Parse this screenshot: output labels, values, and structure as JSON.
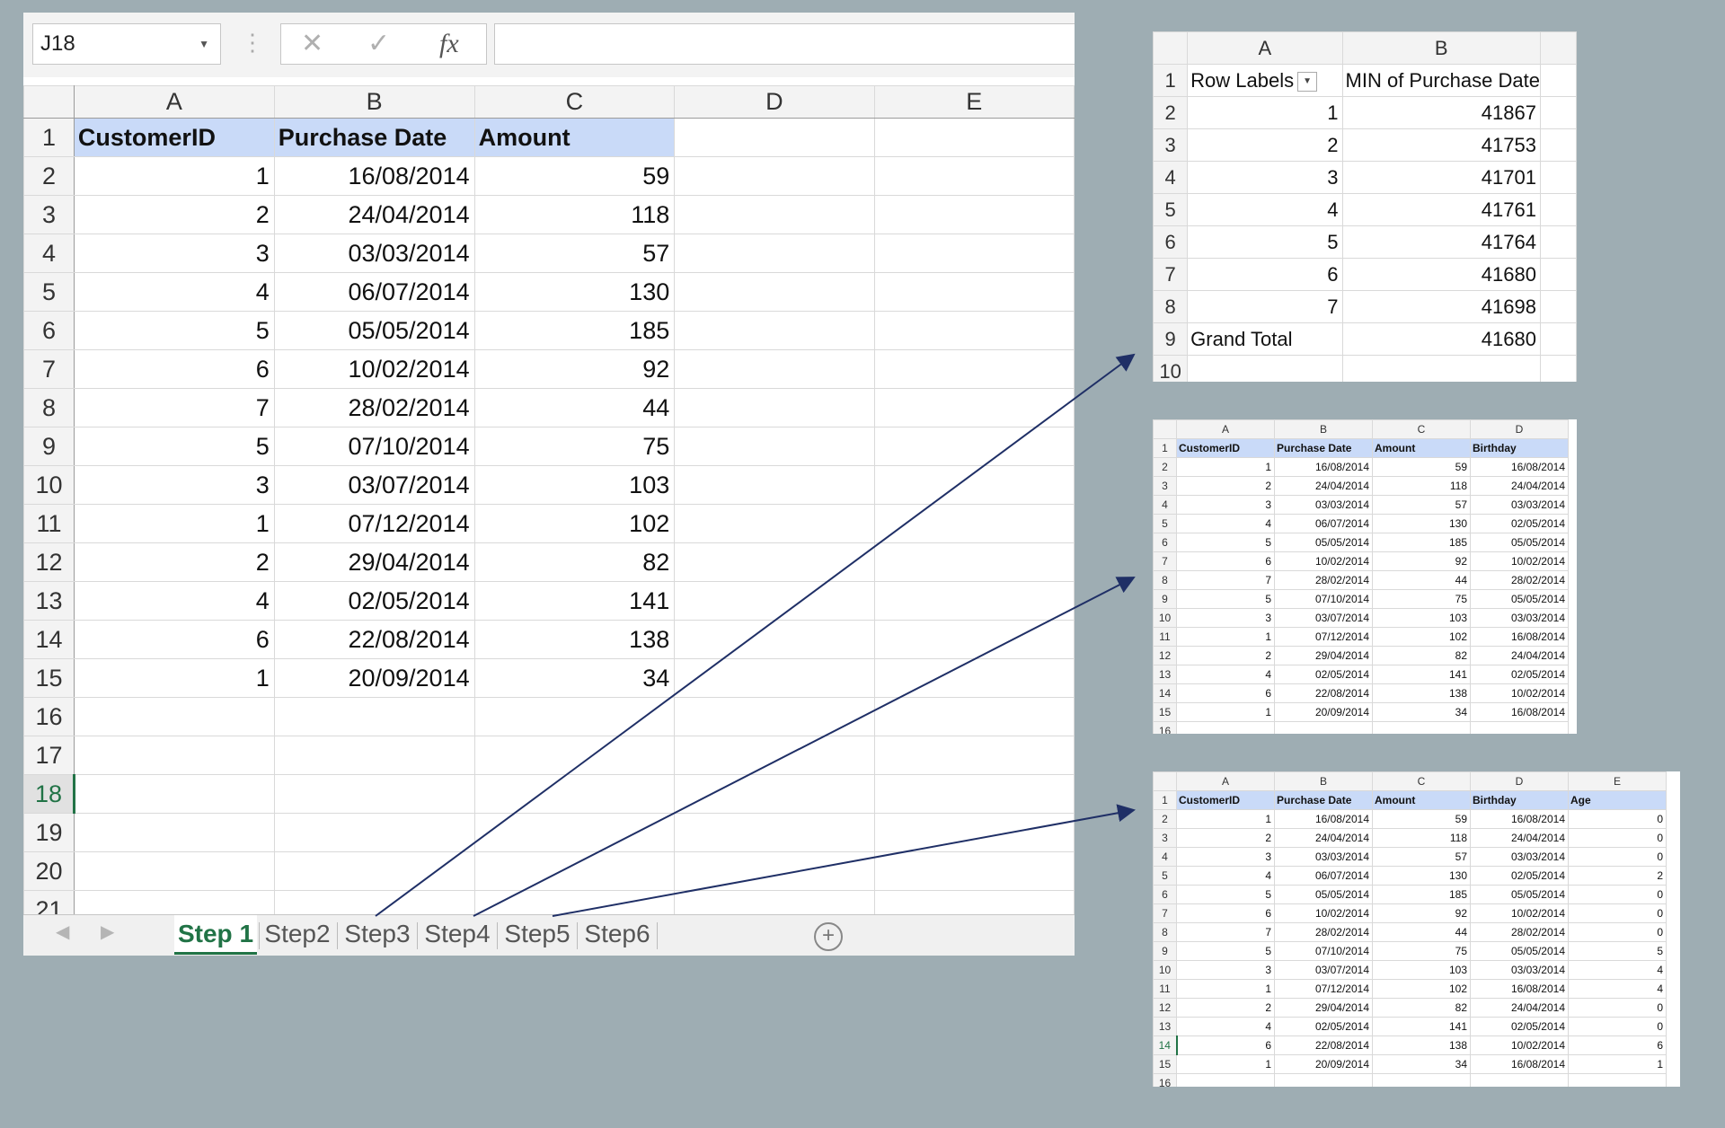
{
  "formula_bar": {
    "name_box": "J18",
    "fx_label": "fx",
    "formula": ""
  },
  "columns": [
    "A",
    "B",
    "C",
    "D",
    "E"
  ],
  "headers": [
    "CustomerID",
    "Purchase Date",
    "Amount"
  ],
  "rows": [
    {
      "id": "1",
      "date": "16/08/2014",
      "amount": "59"
    },
    {
      "id": "2",
      "date": "24/04/2014",
      "amount": "118"
    },
    {
      "id": "3",
      "date": "03/03/2014",
      "amount": "57"
    },
    {
      "id": "4",
      "date": "06/07/2014",
      "amount": "130"
    },
    {
      "id": "5",
      "date": "05/05/2014",
      "amount": "185"
    },
    {
      "id": "6",
      "date": "10/02/2014",
      "amount": "92"
    },
    {
      "id": "7",
      "date": "28/02/2014",
      "amount": "44"
    },
    {
      "id": "5",
      "date": "07/10/2014",
      "amount": "75"
    },
    {
      "id": "3",
      "date": "03/07/2014",
      "amount": "103"
    },
    {
      "id": "1",
      "date": "07/12/2014",
      "amount": "102"
    },
    {
      "id": "2",
      "date": "29/04/2014",
      "amount": "82"
    },
    {
      "id": "4",
      "date": "02/05/2014",
      "amount": "141"
    },
    {
      "id": "6",
      "date": "22/08/2014",
      "amount": "138"
    },
    {
      "id": "1",
      "date": "20/09/2014",
      "amount": "34"
    }
  ],
  "row_numbers": [
    "1",
    "2",
    "3",
    "4",
    "5",
    "6",
    "7",
    "8",
    "9",
    "10",
    "11",
    "12",
    "13",
    "14",
    "15",
    "16",
    "17",
    "18",
    "19",
    "20",
    "21"
  ],
  "selected_row": "18",
  "tabs": [
    "Step 1",
    "Step2",
    "Step3",
    "Step4",
    "Step5",
    "Step6"
  ],
  "active_tab": "Step 1",
  "pivot": {
    "columns": [
      "A",
      "B"
    ],
    "header_a": "Row Labels",
    "header_b": "MIN of Purchase Date",
    "rows": [
      {
        "label": "1",
        "value": "41867"
      },
      {
        "label": "2",
        "value": "41753"
      },
      {
        "label": "3",
        "value": "41701"
      },
      {
        "label": "4",
        "value": "41761"
      },
      {
        "label": "5",
        "value": "41764"
      },
      {
        "label": "6",
        "value": "41680"
      },
      {
        "label": "7",
        "value": "41698"
      }
    ],
    "total_label": "Grand Total",
    "total_value": "41680",
    "row_numbers": [
      "1",
      "2",
      "3",
      "4",
      "5",
      "6",
      "7",
      "8",
      "9",
      "10"
    ]
  },
  "sheet2": {
    "columns": [
      "A",
      "B",
      "C",
      "D"
    ],
    "headers": [
      "CustomerID",
      "Purchase Date",
      "Amount",
      "Birthday"
    ],
    "birthdays": [
      "16/08/2014",
      "24/04/2014",
      "03/03/2014",
      "02/05/2014",
      "05/05/2014",
      "10/02/2014",
      "28/02/2014",
      "05/05/2014",
      "03/03/2014",
      "16/08/2014",
      "24/04/2014",
      "02/05/2014",
      "10/02/2014",
      "16/08/2014"
    ]
  },
  "sheet3": {
    "columns": [
      "A",
      "B",
      "C",
      "D",
      "E"
    ],
    "headers": [
      "CustomerID",
      "Purchase Date",
      "Amount",
      "Birthday",
      "Age"
    ],
    "ages": [
      "0",
      "0",
      "0",
      "2",
      "0",
      "0",
      "0",
      "5",
      "4",
      "4",
      "0",
      "0",
      "6",
      "1"
    ],
    "selected_row": "14"
  }
}
